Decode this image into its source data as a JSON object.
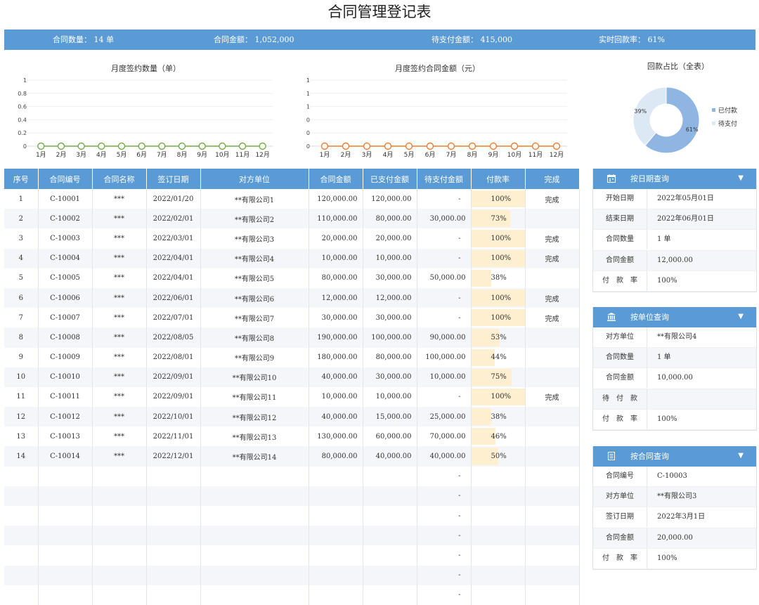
{
  "title": "合同管理登记表",
  "summary": {
    "count": "合同数量： 14 单",
    "amount": "合同金额： 1,052,000",
    "pending": "待支付金额： 415,000",
    "rate": "实时回款率： 61%"
  },
  "chart_data": [
    {
      "type": "line",
      "title": "月度签约数量（单）",
      "categories": [
        "1月",
        "2月",
        "3月",
        "4月",
        "5月",
        "6月",
        "7月",
        "8月",
        "9月",
        "10月",
        "11月",
        "12月"
      ],
      "series": [
        {
          "values": [
            0,
            0,
            0,
            0,
            0,
            0,
            0,
            0,
            0,
            0,
            0,
            0
          ]
        }
      ],
      "yticks": [
        "1",
        "0.8",
        "0.6",
        "0.4",
        "0.2",
        "0"
      ],
      "ylim": [
        0,
        1
      ],
      "color": "#70ad47"
    },
    {
      "type": "line",
      "title": "月度签约合同金额（元）",
      "categories": [
        "1月",
        "2月",
        "3月",
        "4月",
        "5月",
        "6月",
        "7月",
        "8月",
        "9月",
        "10月",
        "11月",
        "12月"
      ],
      "series": [
        {
          "values": [
            0,
            0,
            0,
            0,
            0,
            0,
            0,
            0,
            0,
            0,
            0,
            0
          ]
        }
      ],
      "yticks": [
        "1",
        "1",
        "1",
        "0",
        "0",
        "0"
      ],
      "ylim": [
        0,
        1
      ],
      "color": "#ed7d31"
    },
    {
      "type": "pie",
      "title": "回款占比（全表）",
      "slices": [
        {
          "name": "已付款",
          "value": 61,
          "label": "61%",
          "color": "#8fb5e3"
        },
        {
          "name": "待支付",
          "value": 39,
          "label": "39%",
          "color": "#dde8f5"
        }
      ],
      "legend": "right"
    }
  ],
  "table": {
    "headers": [
      "序号",
      "合同编号",
      "合同名称",
      "签订日期",
      "对方单位",
      "合同金额",
      "已支付金额",
      "待支付金额",
      "付款率",
      "完成"
    ],
    "rows": [
      {
        "no": "1",
        "code": "C-10001",
        "name": "***",
        "date": "2022/01/20",
        "party": "**有限公司1",
        "amount": "120,000.00",
        "paid": "120,000.00",
        "pending": "-",
        "rate": "100%",
        "rate_value": 1.0,
        "done": "完成"
      },
      {
        "no": "2",
        "code": "C-10002",
        "name": "***",
        "date": "2022/02/01",
        "party": "**有限公司2",
        "amount": "110,000.00",
        "paid": "80,000.00",
        "pending": "30,000.00",
        "rate": "73%",
        "rate_value": 0.73,
        "done": ""
      },
      {
        "no": "3",
        "code": "C-10003",
        "name": "***",
        "date": "2022/03/01",
        "party": "**有限公司3",
        "amount": "20,000.00",
        "paid": "20,000.00",
        "pending": "-",
        "rate": "100%",
        "rate_value": 1.0,
        "done": "完成"
      },
      {
        "no": "4",
        "code": "C-10004",
        "name": "***",
        "date": "2022/04/01",
        "party": "**有限公司4",
        "amount": "10,000.00",
        "paid": "10,000.00",
        "pending": "-",
        "rate": "100%",
        "rate_value": 1.0,
        "done": "完成"
      },
      {
        "no": "5",
        "code": "C-10005",
        "name": "***",
        "date": "2022/04/01",
        "party": "**有限公司5",
        "amount": "80,000.00",
        "paid": "30,000.00",
        "pending": "50,000.00",
        "rate": "38%",
        "rate_value": 0.38,
        "done": ""
      },
      {
        "no": "6",
        "code": "C-10006",
        "name": "***",
        "date": "2022/06/01",
        "party": "**有限公司6",
        "amount": "12,000.00",
        "paid": "12,000.00",
        "pending": "-",
        "rate": "100%",
        "rate_value": 1.0,
        "done": "完成"
      },
      {
        "no": "7",
        "code": "C-10007",
        "name": "***",
        "date": "2022/07/01",
        "party": "**有限公司7",
        "amount": "30,000.00",
        "paid": "30,000.00",
        "pending": "-",
        "rate": "100%",
        "rate_value": 1.0,
        "done": "完成"
      },
      {
        "no": "8",
        "code": "C-10008",
        "name": "***",
        "date": "2022/08/05",
        "party": "**有限公司8",
        "amount": "190,000.00",
        "paid": "100,000.00",
        "pending": "90,000.00",
        "rate": "53%",
        "rate_value": 0.53,
        "done": ""
      },
      {
        "no": "9",
        "code": "C-10009",
        "name": "***",
        "date": "2022/08/01",
        "party": "**有限公司9",
        "amount": "180,000.00",
        "paid": "80,000.00",
        "pending": "100,000.00",
        "rate": "44%",
        "rate_value": 0.44,
        "done": ""
      },
      {
        "no": "10",
        "code": "C-10010",
        "name": "***",
        "date": "2022/09/01",
        "party": "**有限公司10",
        "amount": "40,000.00",
        "paid": "30,000.00",
        "pending": "10,000.00",
        "rate": "75%",
        "rate_value": 0.75,
        "done": ""
      },
      {
        "no": "11",
        "code": "C-10011",
        "name": "***",
        "date": "2022/09/01",
        "party": "**有限公司11",
        "amount": "10,000.00",
        "paid": "10,000.00",
        "pending": "-",
        "rate": "100%",
        "rate_value": 1.0,
        "done": "完成"
      },
      {
        "no": "12",
        "code": "C-10012",
        "name": "***",
        "date": "2022/10/01",
        "party": "**有限公司12",
        "amount": "40,000.00",
        "paid": "15,000.00",
        "pending": "25,000.00",
        "rate": "38%",
        "rate_value": 0.38,
        "done": ""
      },
      {
        "no": "13",
        "code": "C-10013",
        "name": "***",
        "date": "2022/11/01",
        "party": "**有限公司13",
        "amount": "130,000.00",
        "paid": "60,000.00",
        "pending": "70,000.00",
        "rate": "46%",
        "rate_value": 0.46,
        "done": ""
      },
      {
        "no": "14",
        "code": "C-10014",
        "name": "***",
        "date": "2022/12/01",
        "party": "**有限公司14",
        "amount": "80,000.00",
        "paid": "40,000.00",
        "pending": "40,000.00",
        "rate": "50%",
        "rate_value": 0.5,
        "done": ""
      }
    ],
    "empty_rows": [
      {
        "pending": "-"
      },
      {
        "pending": "-"
      },
      {
        "pending": "-"
      },
      {
        "pending": "-"
      },
      {
        "pending": "-"
      },
      {
        "pending": "-"
      },
      {
        "pending": "-"
      }
    ]
  },
  "panels": {
    "date_query": {
      "title": "按日期查询",
      "icon": "calendar-icon",
      "arrow": "▼",
      "rows": [
        {
          "label": "开始日期",
          "value": "2022年05月01日"
        },
        {
          "label": "结束日期",
          "value": "2022年06月01日"
        },
        {
          "label": "合同数量",
          "value": "1 单"
        },
        {
          "label": "合同金额",
          "value": "12,000.00"
        },
        {
          "label": "付　款　率",
          "value": "100%"
        }
      ]
    },
    "unit_query": {
      "title": "按单位查询",
      "icon": "bank-icon",
      "arrow": "▼",
      "rows": [
        {
          "label": "对方单位",
          "value": "**有限公司4"
        },
        {
          "label": "合同数量",
          "value": "1 单"
        },
        {
          "label": "合同金额",
          "value": "10,000.00"
        },
        {
          "label": "待　付　款",
          "value": ""
        },
        {
          "label": "付　款　率",
          "value": "100%"
        }
      ]
    },
    "contract_query": {
      "title": "按合同查询",
      "icon": "document-icon",
      "arrow": "▼",
      "rows": [
        {
          "label": "合同编号",
          "value": "C-10003"
        },
        {
          "label": "对方单位",
          "value": "**有限公司3"
        },
        {
          "label": "签订日期",
          "value": "2022年3月1日"
        },
        {
          "label": "合同金额",
          "value": "20,000.00"
        },
        {
          "label": "付　款　率",
          "value": "100%"
        }
      ]
    }
  }
}
